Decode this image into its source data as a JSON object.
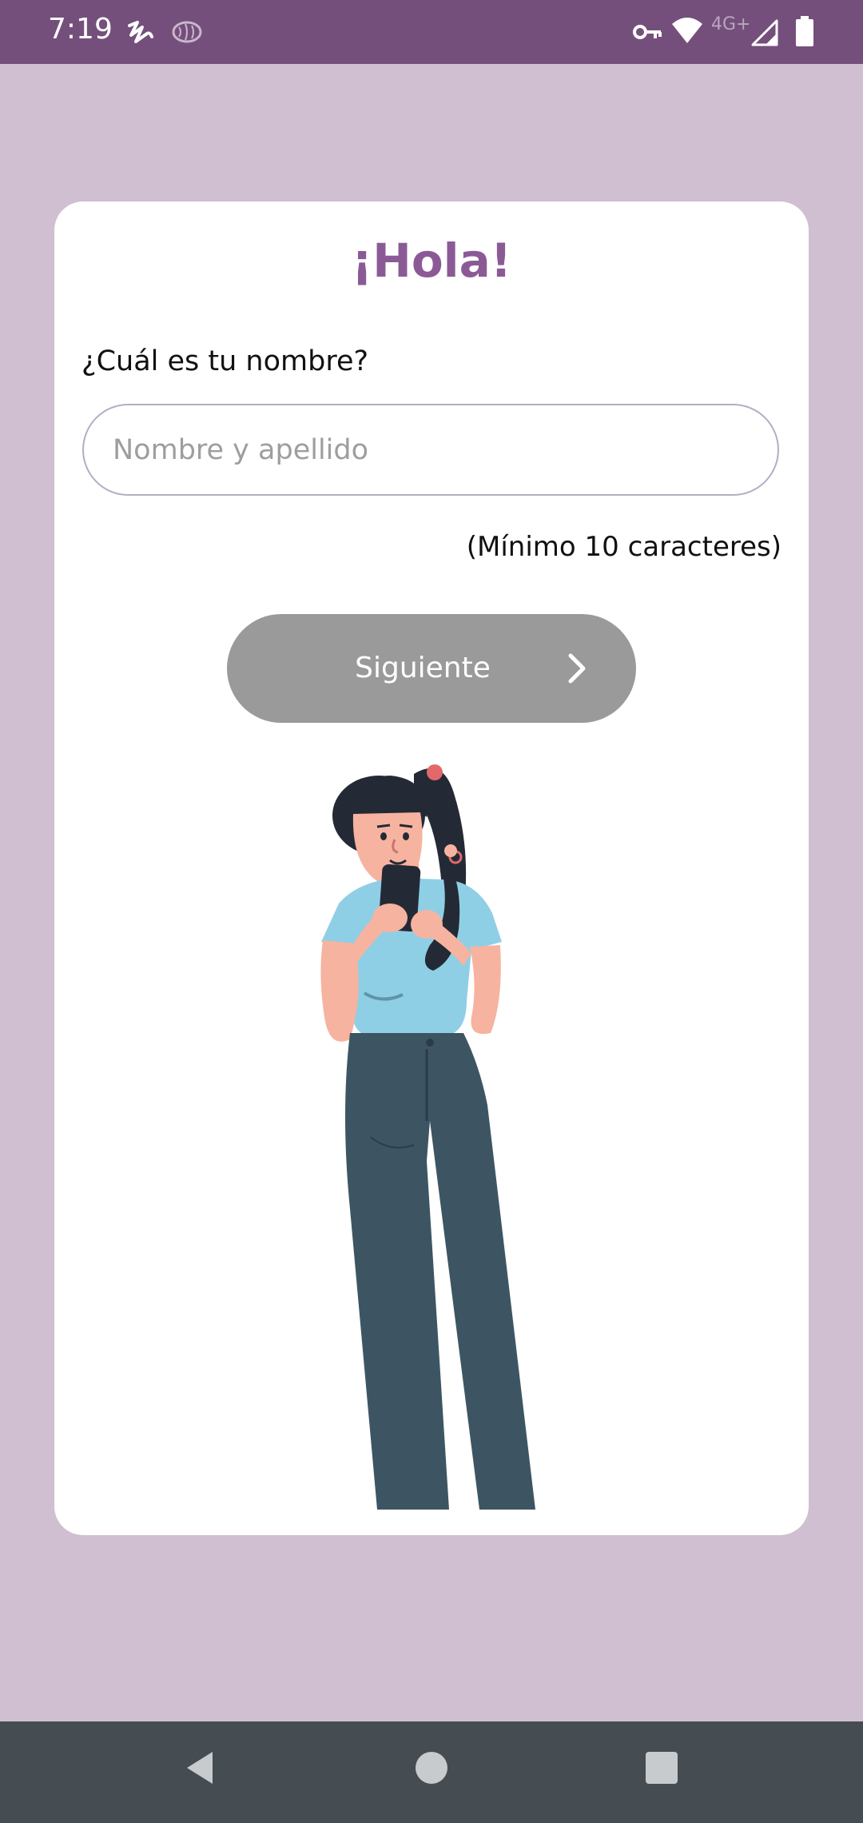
{
  "status_bar": {
    "time": "7:19",
    "network_label": "4G+",
    "icons": [
      "squiggle-app-icon",
      "brain-app-icon",
      "vpn-key-icon",
      "wifi-icon",
      "signal-icon",
      "battery-icon"
    ]
  },
  "greeting": "¡Hola!",
  "form": {
    "question": "¿Cuál es tu nombre?",
    "name_placeholder": "Nombre y apellido",
    "name_value": "",
    "hint": "(Mínimo 10 caracteres)",
    "next_label": "Siguiente",
    "next_icon": "chevron-right-icon"
  },
  "illustration": "woman-with-phone-illustration",
  "navigation": {
    "icons": [
      "back-icon",
      "home-icon",
      "recents-icon"
    ]
  },
  "colors": {
    "status_bar": "#754f7c",
    "background": "#cfbfd0",
    "accent": "#8b5a96",
    "button_disabled": "#9a9a9a",
    "nav_bar": "#454c52"
  }
}
